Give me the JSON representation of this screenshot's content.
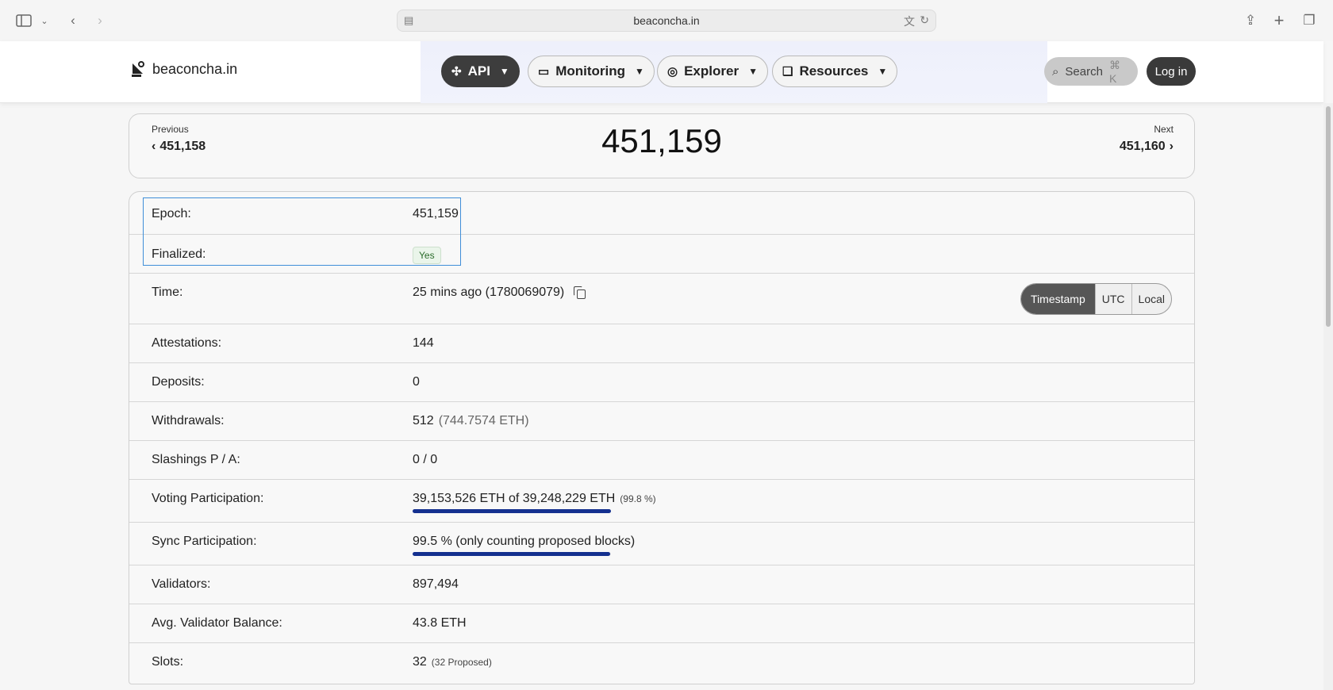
{
  "browser": {
    "url": "beaconcha.in"
  },
  "header": {
    "logo_text": "beaconcha.in",
    "nav": [
      {
        "label": "API",
        "icon": "api-icon"
      },
      {
        "label": "Monitoring",
        "icon": "monitor-icon"
      },
      {
        "label": "Explorer",
        "icon": "compass-icon"
      },
      {
        "label": "Resources",
        "icon": "book-icon"
      }
    ],
    "search_label": "Search",
    "search_shortcut": "⌘ K",
    "login_label": "Log in"
  },
  "epoch_nav": {
    "previous_label": "Previous",
    "previous_value": "451,158",
    "current": "451,159",
    "next_label": "Next",
    "next_value": "451,160"
  },
  "details": {
    "epoch": {
      "label": "Epoch:",
      "value": "451,159"
    },
    "finalized": {
      "label": "Finalized:",
      "value": "Yes"
    },
    "time": {
      "label": "Time:",
      "value": "25 mins ago (1780069079)",
      "formats": [
        "Timestamp",
        "UTC",
        "Local"
      ],
      "active_format": "Timestamp"
    },
    "attestations": {
      "label": "Attestations:",
      "value": "144"
    },
    "deposits": {
      "label": "Deposits:",
      "value": "0"
    },
    "withdrawals": {
      "label": "Withdrawals:",
      "value": "512",
      "extra": "(744.7574 ETH)"
    },
    "slashings": {
      "label": "Slashings P / A:",
      "value": "0 / 0"
    },
    "voting": {
      "label": "Voting Participation:",
      "value": "39,153,526 ETH of 39,248,229 ETH",
      "extra": "(99.8 %)",
      "progress": 0.998
    },
    "sync": {
      "label": "Sync Participation:",
      "value": "99.5 % (only counting proposed blocks)",
      "progress": 0.995
    },
    "validators": {
      "label": "Validators:",
      "value": "897,494"
    },
    "avg_balance": {
      "label": "Avg. Validator Balance:",
      "value": "43.8 ETH"
    },
    "slots": {
      "label": "Slots:",
      "value": "32",
      "extra": "(32 Proposed)"
    }
  },
  "colors": {
    "progress_fill": "#14308f",
    "finalized_badge": "#eaf5ea",
    "highlight": "#3f8ed8"
  }
}
